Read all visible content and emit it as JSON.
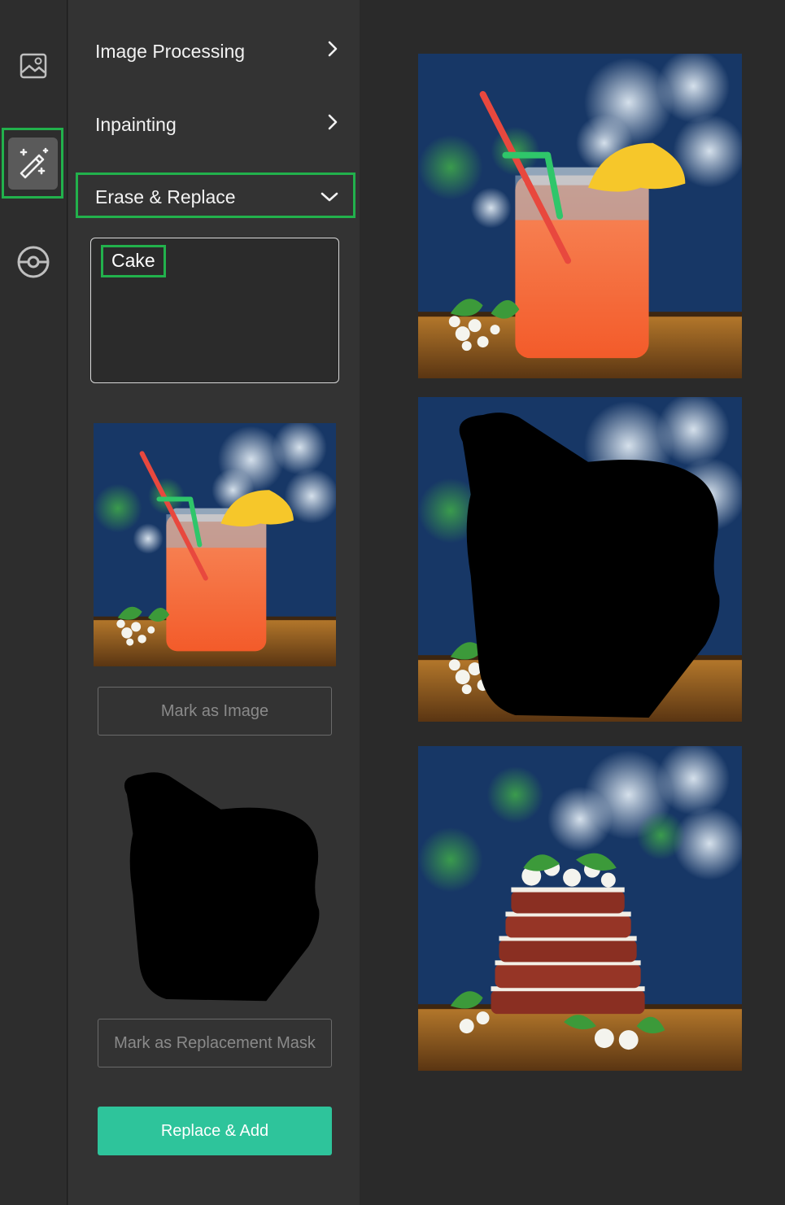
{
  "rail": {
    "items": [
      {
        "icon": "image-icon"
      },
      {
        "icon": "magic-wand-icon",
        "active": true
      },
      {
        "icon": "eye-circle-icon"
      }
    ]
  },
  "panel": {
    "accordion": [
      {
        "label": "Image Processing",
        "icon": "chevron-right-icon"
      },
      {
        "label": "Inpainting",
        "icon": "chevron-right-icon"
      },
      {
        "label": "Erase & Replace",
        "icon": "chevron-down-icon",
        "expanded": true
      }
    ],
    "prompt_value": "Cake",
    "buttons": {
      "mark_image": "Mark as Image",
      "mark_mask": "Mark as Replacement Mask",
      "replace_add": "Replace & Add"
    }
  },
  "gallery": {
    "images": [
      {
        "alt": "drink-photo"
      },
      {
        "alt": "masked-drink-photo"
      },
      {
        "alt": "cake-result-photo"
      }
    ]
  },
  "colors": {
    "accent": "#2ec49b",
    "highlight": "#22b14c"
  }
}
